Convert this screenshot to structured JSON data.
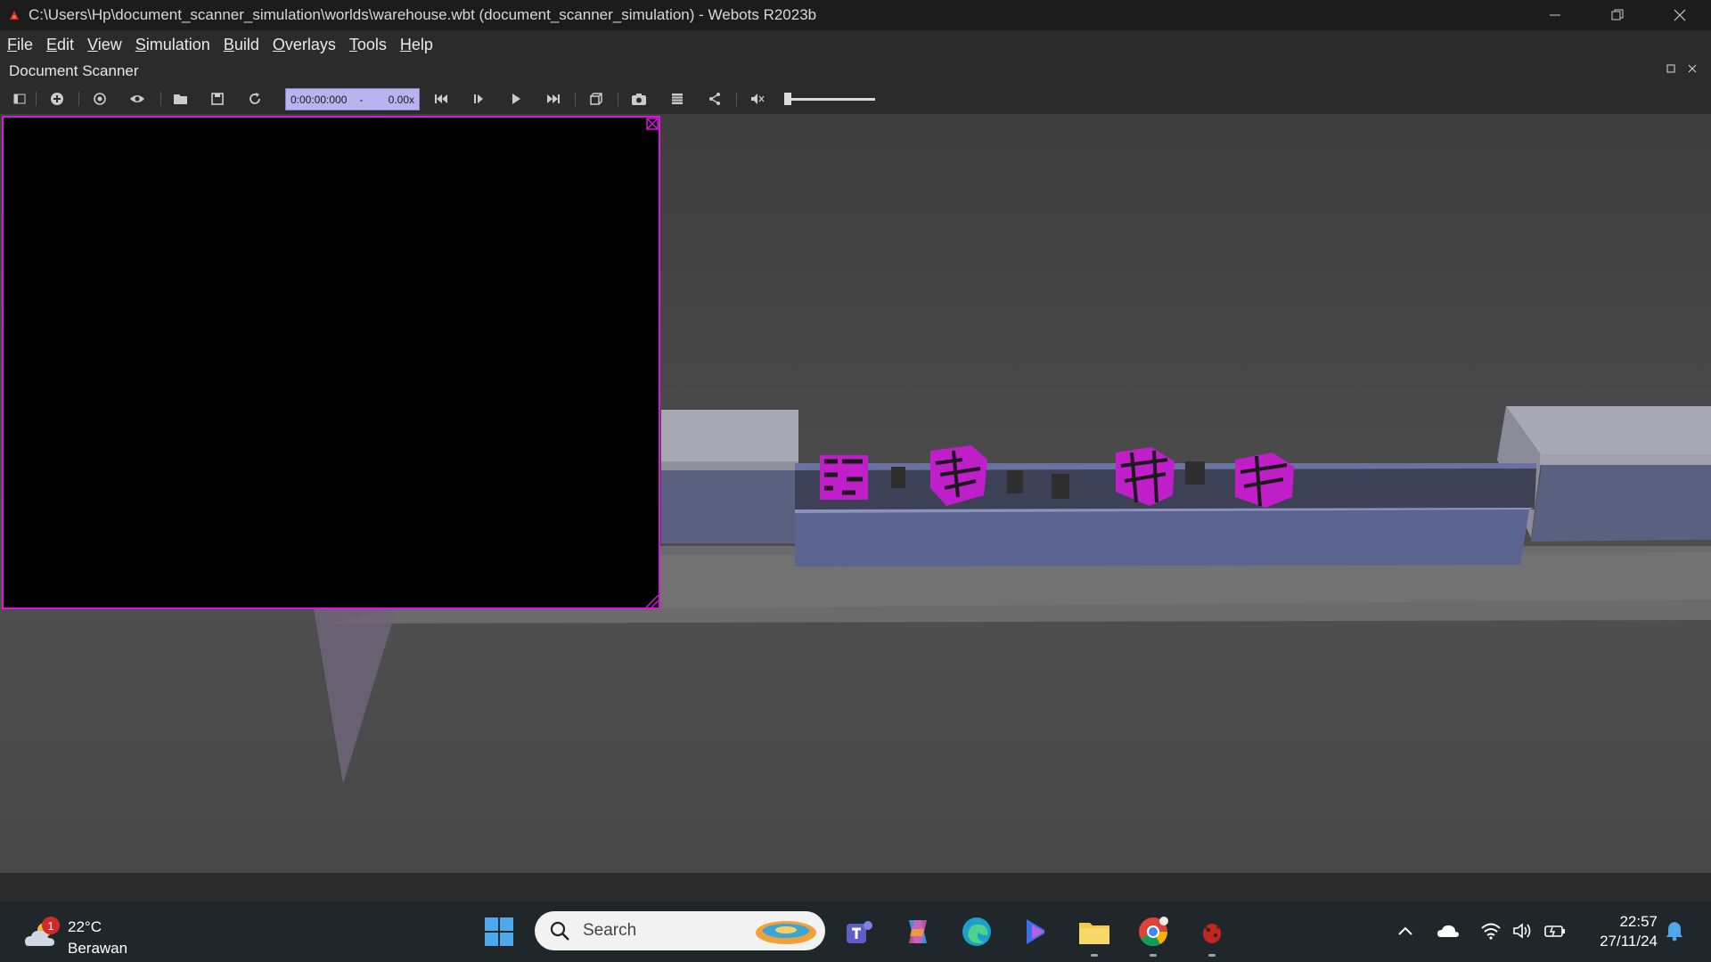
{
  "window": {
    "title": "C:\\Users\\Hp\\document_scanner_simulation\\worlds\\warehouse.wbt (document_scanner_simulation) - Webots R2023b",
    "controls": [
      "minimize-icon",
      "restore-icon",
      "close-icon"
    ]
  },
  "menu": {
    "items": [
      {
        "first": "F",
        "rest": "ile"
      },
      {
        "first": "E",
        "rest": "dit"
      },
      {
        "first": "V",
        "rest": "iew"
      },
      {
        "first": "S",
        "rest": "imulation"
      },
      {
        "first": "B",
        "rest": "uild"
      },
      {
        "first": "O",
        "rest": "verlays"
      },
      {
        "first": "T",
        "rest": "ools"
      },
      {
        "first": "H",
        "rest": "elp"
      }
    ]
  },
  "dock": {
    "title": "Document Scanner"
  },
  "toolbar": {
    "time": "0:00:00:000",
    "time_separator": "-",
    "speed": "0.00x",
    "icons": [
      "scene-tree-toggle-icon",
      "add-node-icon",
      "reset-view-icon",
      "eye-icon",
      "open-world-icon",
      "save-world-icon",
      "reload-world-icon",
      "skip-back-icon",
      "step-icon",
      "play-icon",
      "fast-forward-icon",
      "view-cube-icon",
      "camera-icon",
      "record-movie-icon",
      "share-icon",
      "mute-icon"
    ],
    "volume_level": 0
  },
  "taskbar": {
    "weather": {
      "temp": "22°C",
      "condition": "Berawan",
      "badge": "1"
    },
    "search": {
      "label": "Search"
    },
    "apps": [
      "windows-start-icon",
      "teams-icon",
      "copilot-icon",
      "edge-icon",
      "copilot-app-icon",
      "file-explorer-icon",
      "chrome-icon",
      "webots-icon"
    ],
    "tray": [
      "chevron-up-icon",
      "onedrive-icon",
      "wifi-icon",
      "volume-icon",
      "battery-icon"
    ],
    "clock": {
      "time": "22:57",
      "date": "27/11/24"
    },
    "notification_icon": "bell-icon"
  },
  "colors": {
    "overlay_border": "#d916d9",
    "time_box_bg": "#b9b4f0",
    "cube_magenta": "#c01ec8",
    "conveyor_blue": "#5b6491"
  }
}
